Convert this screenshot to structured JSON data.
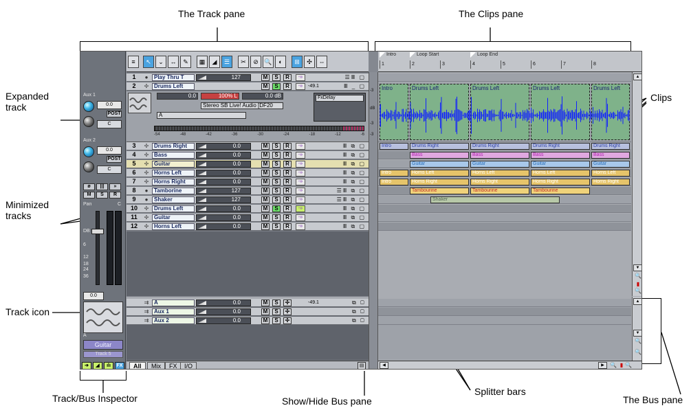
{
  "annotations": {
    "track_pane": "The Track pane",
    "clips_pane": "The Clips pane",
    "expanded_track": "Expanded track",
    "clips": "Clips",
    "minimized_tracks": "Minimized tracks",
    "track_icon": "Track icon",
    "inspector": "Track/Bus Inspector",
    "show_hide_bus": "Show/Hide Bus pane",
    "splitter_bars": "Splitter bars",
    "bus_pane": "The Bus pane"
  },
  "inspector": {
    "aux1": "Aux 1",
    "aux1_value": "0.0",
    "aux1_pan": "C",
    "aux2": "Aux 2",
    "aux2_value": "0.0",
    "aux2_pan": "C",
    "post": "POST",
    "m": "M",
    "s": "S",
    "r": "R",
    "pan": "Pan",
    "pan_value": "C",
    "db": "DB",
    "vol_value": "0.0",
    "fader_scale": [
      "6",
      "12",
      "18",
      "24",
      "36"
    ],
    "input": "A",
    "track_name": "Guitar",
    "track_number": "Track 5",
    "fx": "FX"
  },
  "tracks": {
    "expanded": {
      "num": "1",
      "name": "Play Thru T",
      "vol": "127"
    },
    "drums_left": {
      "num": "2",
      "name": "Drums Left",
      "level": "-49.1",
      "volume": "0.0",
      "pan": "100% L",
      "gain": "0.0 dB",
      "output": "Stereo SB Live! Audio [DF20",
      "input": "A",
      "fx": "FxDelay",
      "scale": [
        "-54",
        "-48",
        "-42",
        "-36",
        "-30",
        "-24",
        "-18",
        "-12",
        "-6"
      ]
    },
    "rows": [
      {
        "num": "3",
        "name": "Drums Right",
        "vol": "0.0"
      },
      {
        "num": "4",
        "name": "Bass",
        "vol": "0.0"
      },
      {
        "num": "5",
        "name": "Guitar",
        "vol": "0.0"
      },
      {
        "num": "6",
        "name": "Horns Left",
        "vol": "0.0"
      },
      {
        "num": "7",
        "name": "Horns Right",
        "vol": "0.0"
      },
      {
        "num": "8",
        "name": "Tamborine",
        "vol": "127"
      },
      {
        "num": "9",
        "name": "Shaker",
        "vol": "127"
      },
      {
        "num": "10",
        "name": "Drums Left",
        "vol": "0.0"
      },
      {
        "num": "11",
        "name": "Guitar",
        "vol": "0.0"
      },
      {
        "num": "12",
        "name": "Horns Left",
        "vol": "0.0"
      }
    ],
    "msr": {
      "m": "M",
      "s": "S",
      "r": "R"
    }
  },
  "buses": [
    {
      "name": "A",
      "vol": "0.0",
      "level": "-49.1"
    },
    {
      "name": "Aux 1",
      "vol": "0.0"
    },
    {
      "name": "Aux 2",
      "vol": "0.0"
    }
  ],
  "tabs": [
    "All",
    "Mix",
    "FX",
    "I/O"
  ],
  "timeline": {
    "markers": [
      "Intro",
      "Loop Start",
      "Loop End"
    ],
    "bars": [
      "1",
      "2",
      "3",
      "4",
      "5",
      "6",
      "7",
      "8"
    ]
  },
  "clips": {
    "expanded": [
      "Intro",
      "Drums Left",
      "Drums Left",
      "Drums Left",
      "Drums Left"
    ],
    "drums_right": [
      "Intro",
      "Drums Right",
      "Drums Right",
      "Drums Right",
      "Drums Right"
    ],
    "bass": [
      "Bass",
      "Bass",
      "Bass",
      "Bass"
    ],
    "guitar": [
      "Guitar",
      "Guitar",
      "Guitar",
      "Guitar"
    ],
    "horns_left": [
      "Intro",
      "Horns Left",
      "Horns Left",
      "Horns Left",
      "Horns Left"
    ],
    "horns_right": [
      "Intro",
      "Horns Right",
      "Horns Right",
      "Horns Right",
      "Horns Right"
    ],
    "tambourine": [
      "Tambourine",
      "Tambourine",
      "Tambourine"
    ],
    "shaker": [
      "Shaker"
    ]
  },
  "db_labels": [
    "-3",
    "dB",
    "-3",
    "-3"
  ],
  "colors": {
    "accent_blue": "#4aa3e0",
    "solo_green": "#6ee06a",
    "clip_green": "#7fb28a",
    "waveform_blue": "#1020ff"
  }
}
